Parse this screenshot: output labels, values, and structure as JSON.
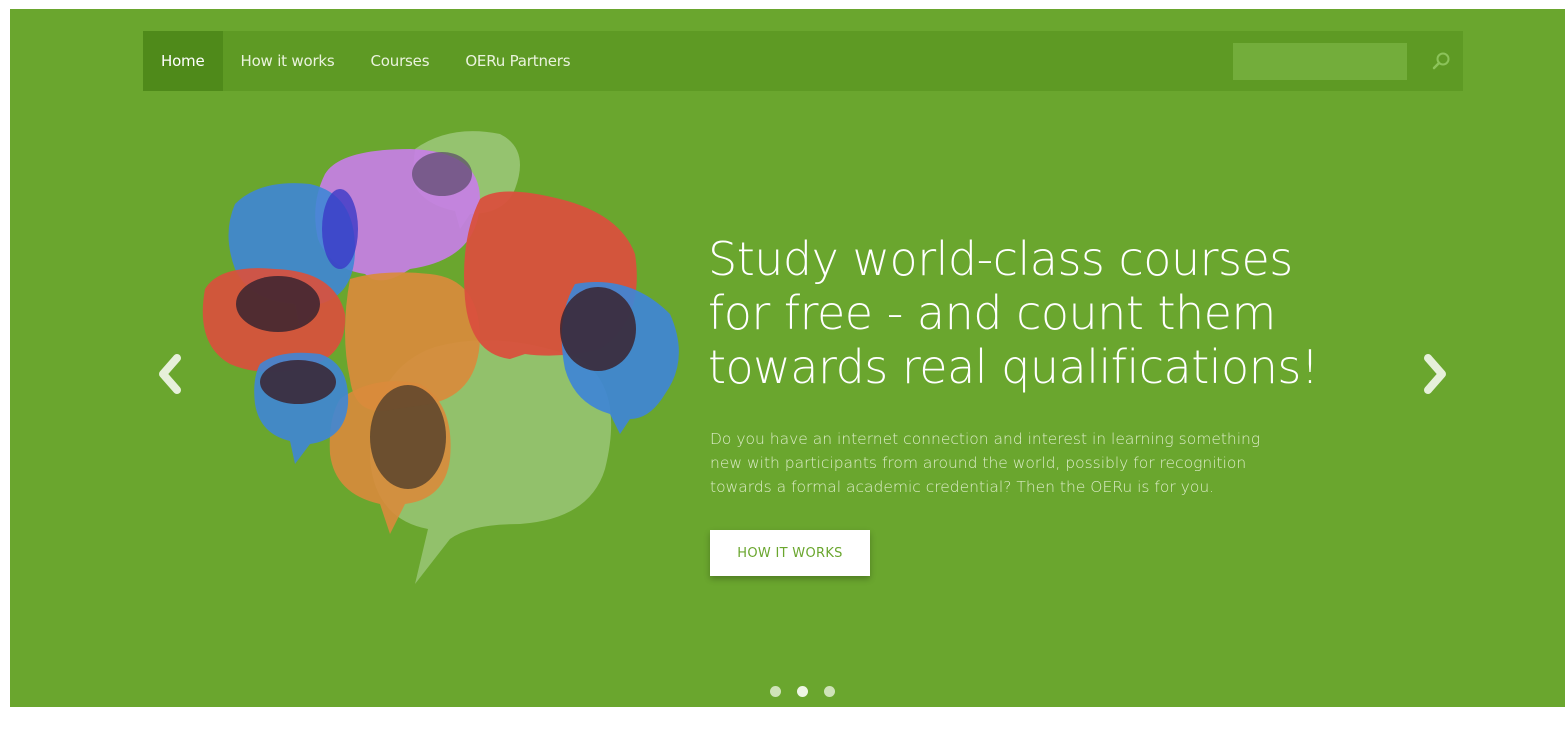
{
  "nav": {
    "items": [
      {
        "label": "Home",
        "active": true
      },
      {
        "label": "How it works",
        "active": false
      },
      {
        "label": "Courses",
        "active": false
      },
      {
        "label": "OERu Partners",
        "active": false
      }
    ],
    "search_placeholder": "",
    "search_icon": "search-icon"
  },
  "hero": {
    "headline_lines": [
      "Study world-class courses",
      "for free - and count them",
      "towards real qualifications!"
    ],
    "lead_lines": [
      "Do you have an internet connection and interest in learning something",
      "new with participants from around the world, possibly for recognition",
      "towards a formal academic credential? Then the OERu is for you."
    ],
    "cta_label": "HOW IT WORKS",
    "prev_icon": "chevron-left-icon",
    "next_icon": "chevron-right-icon",
    "slide_count": 3,
    "active_slide": 2
  },
  "colors": {
    "background": "#6aa62e",
    "navbar": "#5e9a24",
    "nav_active": "#4f8a1a",
    "bubble_blue": "#3f86d6",
    "bubble_purple": "#c77fe6",
    "bubble_red": "#d9503d",
    "bubble_orange": "#d98b3c",
    "bubble_lightgreen": "#9cc87a",
    "bubble_dark": "#3a2430"
  }
}
